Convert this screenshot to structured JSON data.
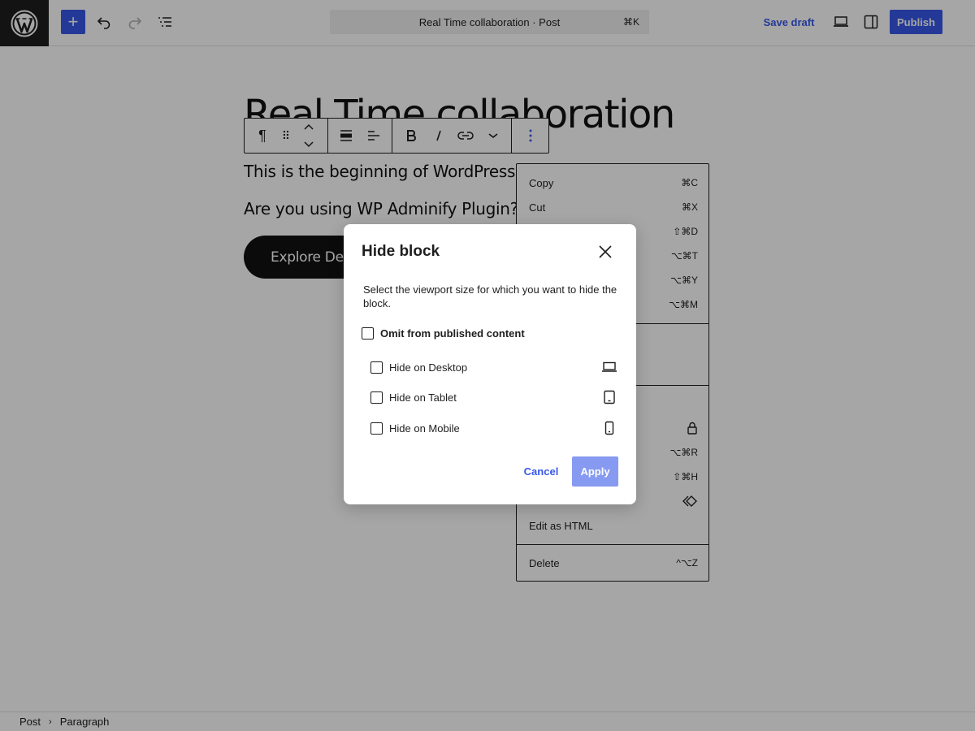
{
  "topbar": {
    "command_title": "Real Time collaboration · Post",
    "command_shortcut": "⌘K",
    "save_draft": "Save draft",
    "publish": "Publish",
    "inserter_symbol": "+"
  },
  "content": {
    "title": "Real Time collaboration",
    "paragraph1": "This is the beginning of WordPress 7.0",
    "paragraph2": "Are you using WP Adminify Plugin?",
    "button": "Explore Details"
  },
  "block_toolbar": {
    "paragraph_symbol": "¶",
    "drag_symbol": "⠿"
  },
  "block_menu": {
    "items": [
      {
        "label": "Copy",
        "shortcut": "⌘C"
      },
      {
        "label": "Cut",
        "shortcut": "⌘X"
      },
      {
        "label": "",
        "shortcut": "⇧⌘D"
      },
      {
        "label": "",
        "shortcut": "⌥⌘T"
      },
      {
        "label": "",
        "shortcut": "⌥⌘Y"
      },
      {
        "label": "",
        "shortcut": "⌥⌘M"
      },
      {
        "label": "",
        "shortcut": "⌥⌘R"
      },
      {
        "label": "",
        "shortcut": "⇧⌘H"
      },
      {
        "label": "Edit as HTML",
        "shortcut": ""
      },
      {
        "label": "Delete",
        "shortcut": "^⌥Z"
      }
    ]
  },
  "modal": {
    "title": "Hide block",
    "description": "Select the viewport size for which you want to hide the block.",
    "omit_label": "Omit from published content",
    "options": [
      {
        "label": "Hide on Desktop",
        "icon": "laptop-icon"
      },
      {
        "label": "Hide on Tablet",
        "icon": "tablet-icon"
      },
      {
        "label": "Hide on Mobile",
        "icon": "mobile-icon"
      }
    ],
    "cancel": "Cancel",
    "apply": "Apply"
  },
  "footer": {
    "breadcrumb": [
      "Post",
      "Paragraph"
    ]
  },
  "colors": {
    "accent": "#3858e9",
    "dark": "#1e1e1e"
  }
}
